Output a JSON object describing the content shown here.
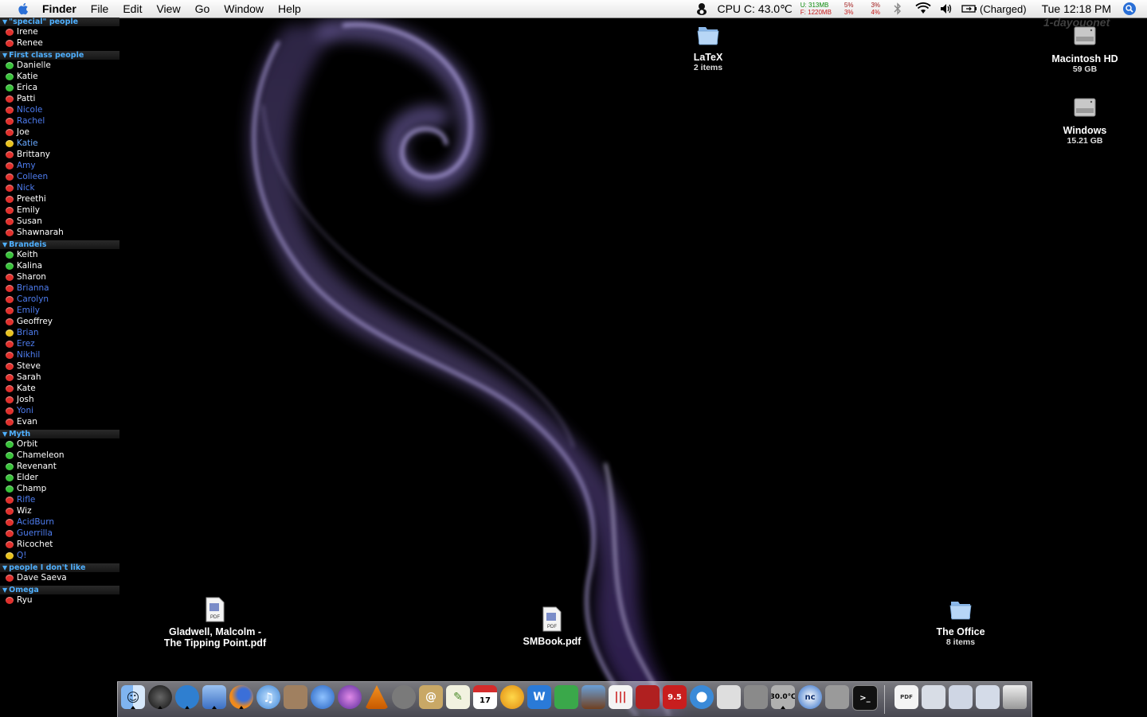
{
  "menubar": {
    "app_name": "Finder",
    "menus": [
      "File",
      "Edit",
      "View",
      "Go",
      "Window",
      "Help"
    ],
    "cpu_temp": "CPU C:  43.0℃",
    "memory_used": "U:  313MB",
    "memory_free": "F: 1220MB",
    "cpu_load_1": [
      "5%",
      "3%"
    ],
    "cpu_load_2": [
      "3%",
      "4%"
    ],
    "battery_status": "(Charged)",
    "clock": "Tue 12:18 PM",
    "watermark": "1-dayouonet"
  },
  "buddy_groups": [
    {
      "name": "\"special\" people",
      "buddies": [
        {
          "name": "Irene",
          "status": "red",
          "color": "white"
        },
        {
          "name": "Renee",
          "status": "red",
          "color": "white"
        }
      ]
    },
    {
      "name": "First class  people",
      "buddies": [
        {
          "name": "Danielle",
          "status": "green",
          "color": "white"
        },
        {
          "name": "Katie",
          "status": "green",
          "color": "white"
        },
        {
          "name": "Erica",
          "status": "green",
          "color": "white"
        },
        {
          "name": "Patti",
          "status": "red",
          "color": "white"
        },
        {
          "name": "Nicole",
          "status": "red",
          "color": "blue"
        },
        {
          "name": "Rachel",
          "status": "red",
          "color": "blue"
        },
        {
          "name": "Joe",
          "status": "red",
          "color": "white"
        },
        {
          "name": "Katie",
          "status": "yellow",
          "color": "lightblue"
        },
        {
          "name": "Brittany",
          "status": "red",
          "color": "white"
        },
        {
          "name": "Amy",
          "status": "red",
          "color": "blue"
        },
        {
          "name": "Colleen",
          "status": "red",
          "color": "blue"
        },
        {
          "name": "Nick",
          "status": "red",
          "color": "blue"
        },
        {
          "name": "Preethi",
          "status": "red",
          "color": "white"
        },
        {
          "name": "Emily",
          "status": "red",
          "color": "white"
        },
        {
          "name": "Susan",
          "status": "red",
          "color": "white"
        },
        {
          "name": "Shawnarah",
          "status": "red",
          "color": "white"
        }
      ]
    },
    {
      "name": "Brandeis",
      "buddies": [
        {
          "name": "Keith",
          "status": "green",
          "color": "white"
        },
        {
          "name": "Kalina",
          "status": "green",
          "color": "white"
        },
        {
          "name": "Sharon",
          "status": "red",
          "color": "white"
        },
        {
          "name": "Brianna",
          "status": "red",
          "color": "blue"
        },
        {
          "name": "Carolyn",
          "status": "red",
          "color": "blue"
        },
        {
          "name": "Emily",
          "status": "red",
          "color": "blue"
        },
        {
          "name": "Geoffrey",
          "status": "red",
          "color": "white"
        },
        {
          "name": "Brian",
          "status": "yellow",
          "color": "blue"
        },
        {
          "name": "Erez",
          "status": "red",
          "color": "blue"
        },
        {
          "name": "Nikhil",
          "status": "red",
          "color": "blue"
        },
        {
          "name": "Steve",
          "status": "red",
          "color": "white"
        },
        {
          "name": "Sarah",
          "status": "red",
          "color": "white"
        },
        {
          "name": "Kate",
          "status": "red",
          "color": "white"
        },
        {
          "name": "Josh",
          "status": "red",
          "color": "white"
        },
        {
          "name": "Yoni",
          "status": "red",
          "color": "blue"
        },
        {
          "name": "Evan",
          "status": "red",
          "color": "white"
        }
      ]
    },
    {
      "name": "Myth",
      "buddies": [
        {
          "name": "Orbit",
          "status": "green",
          "color": "white"
        },
        {
          "name": "Chameleon",
          "status": "green",
          "color": "white"
        },
        {
          "name": "Revenant",
          "status": "green",
          "color": "white"
        },
        {
          "name": "Elder",
          "status": "green",
          "color": "white"
        },
        {
          "name": "Champ",
          "status": "green",
          "color": "white"
        },
        {
          "name": "Rifle",
          "status": "red",
          "color": "blue"
        },
        {
          "name": "Wiz",
          "status": "red",
          "color": "white"
        },
        {
          "name": "AcidBurn",
          "status": "red",
          "color": "blue"
        },
        {
          "name": "Guerrilla",
          "status": "red",
          "color": "blue"
        },
        {
          "name": "Ricochet",
          "status": "red",
          "color": "white"
        },
        {
          "name": "Q!",
          "status": "yellow",
          "color": "blue"
        }
      ]
    },
    {
      "name": "people I don't like",
      "buddies": [
        {
          "name": "Dave Saeva",
          "status": "red",
          "color": "white"
        }
      ]
    },
    {
      "name": "Omega",
      "buddies": [
        {
          "name": "Ryu",
          "status": "red",
          "color": "white"
        }
      ]
    }
  ],
  "desktop": {
    "latex": {
      "label": "LaTeX",
      "sub": "2 items"
    },
    "macintosh_hd": {
      "label": "Macintosh HD",
      "sub": "59 GB"
    },
    "windows": {
      "label": "Windows",
      "sub": "15.21 GB"
    },
    "gladwell_pdf": {
      "label_line1": "Gladwell, Malcolm -",
      "label_line2": "The Tipping Point.pdf"
    },
    "smbook_pdf": {
      "label": "SMBook.pdf"
    },
    "the_office": {
      "label": "The Office",
      "sub": "8 items"
    }
  },
  "dock": {
    "calendar_day": "17",
    "temp_widget": "30.0℃",
    "badge_number": "9.5"
  }
}
